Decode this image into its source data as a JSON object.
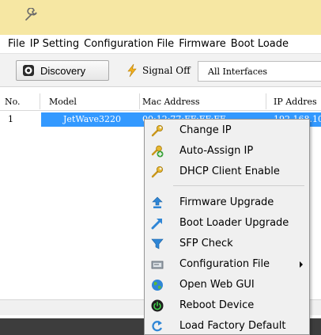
{
  "menu": [
    "File",
    "IP Setting",
    "Configuration File",
    "Firmware",
    "Boot Loade"
  ],
  "toolbar": {
    "discovery_label": "Discovery",
    "signal_label": "Signal Off",
    "interfaces_value": "All Interfaces"
  },
  "table": {
    "columns": [
      "No.",
      "Model",
      "Mac Address",
      "IP Addres"
    ],
    "row": {
      "no": "1",
      "model": "JetWave3220",
      "mac": "00:12:77:FF:FF:FF",
      "ip": "192.168.10"
    }
  },
  "context_menu": {
    "items": [
      {
        "label": "Change IP",
        "icon": "wrench-icon"
      },
      {
        "label": "Auto-Assign IP",
        "icon": "wrench-plus-icon"
      },
      {
        "label": "DHCP Client Enable",
        "icon": "wrench-icon"
      },
      {
        "label": "Firmware Upgrade",
        "icon": "upload-arrow-icon"
      },
      {
        "label": "Boot Loader Upgrade",
        "icon": "diagonal-arrow-icon"
      },
      {
        "label": "SFP Check",
        "icon": "funnel-icon"
      },
      {
        "label": "Configuration File",
        "icon": "config-file-icon"
      },
      {
        "label": "Open Web GUI",
        "icon": "globe-icon"
      },
      {
        "label": "Reboot Device",
        "icon": "power-icon"
      },
      {
        "label": "Load Factory Default",
        "icon": "reset-icon"
      }
    ]
  },
  "colors": {
    "titlebar": "#f6e7a3",
    "selection": "#3399ff",
    "menu_bg": "#f0f0f0",
    "statusbar": "#3d3d3d"
  }
}
